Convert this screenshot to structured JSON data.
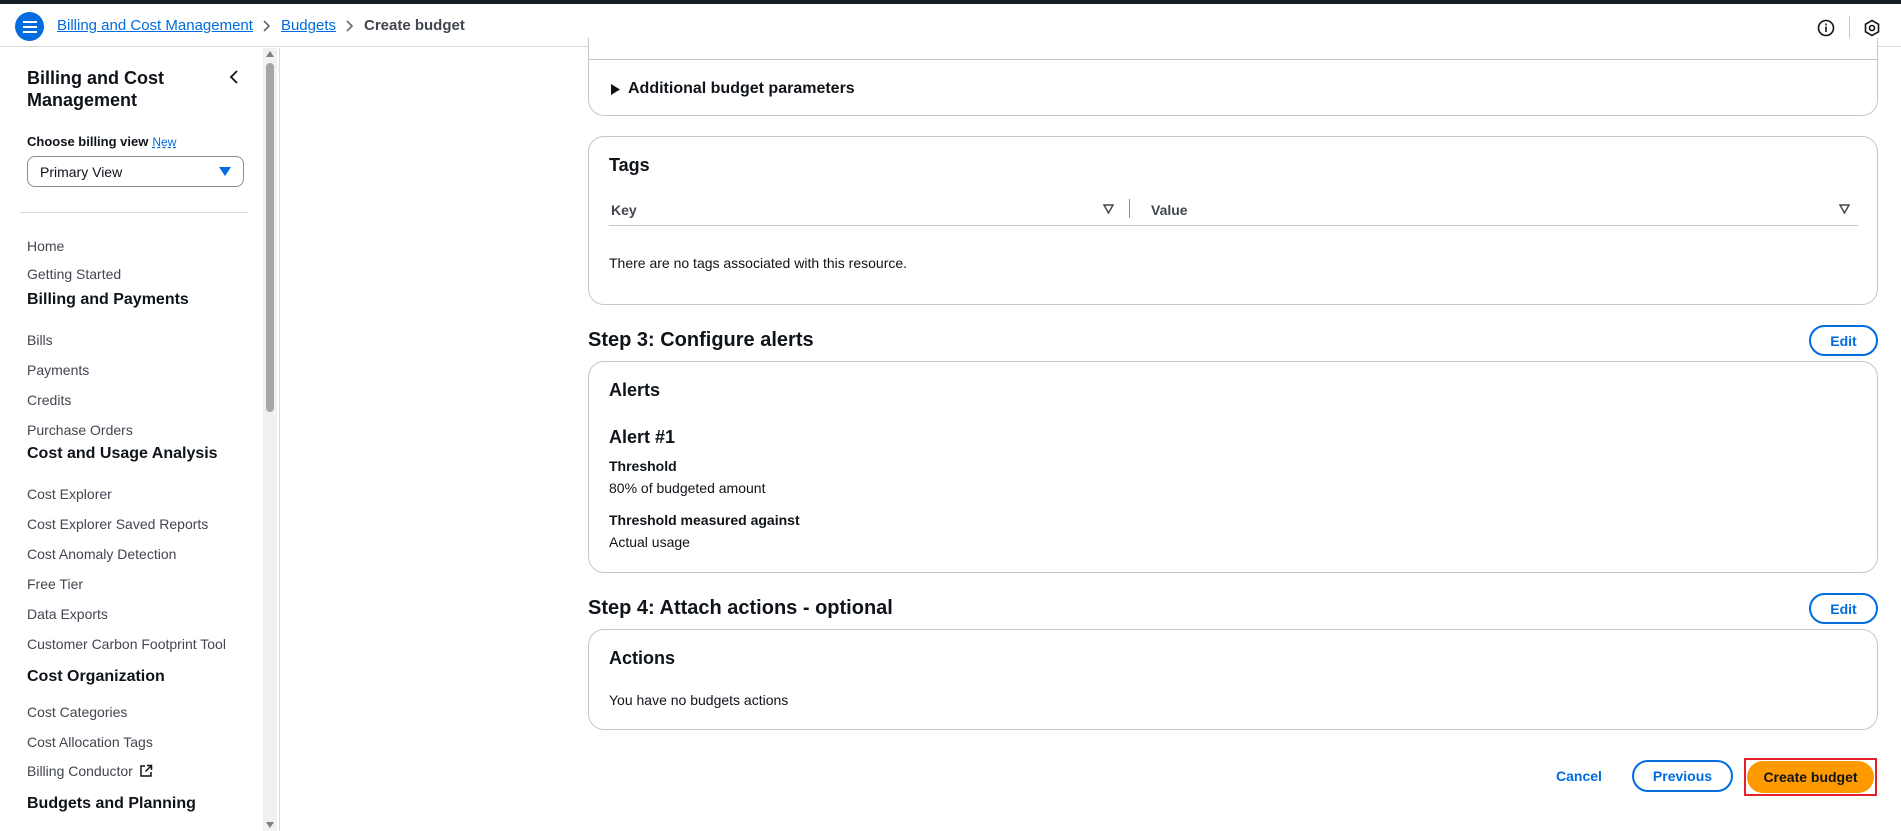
{
  "header": {
    "breadcrumbs": [
      "Billing and Cost Management",
      "Budgets",
      "Create budget"
    ]
  },
  "sidebar": {
    "title": "Billing and Cost Management",
    "choose_view_label": "Choose billing view",
    "new_badge": "New",
    "selected_view": "Primary View",
    "items": [
      {
        "type": "link",
        "label": "Home"
      },
      {
        "type": "link",
        "label": "Getting Started"
      },
      {
        "type": "heading",
        "label": "Billing and Payments"
      },
      {
        "type": "link",
        "label": "Bills"
      },
      {
        "type": "link",
        "label": "Payments"
      },
      {
        "type": "link",
        "label": "Credits"
      },
      {
        "type": "link",
        "label": "Purchase Orders"
      },
      {
        "type": "heading",
        "label": "Cost and Usage Analysis"
      },
      {
        "type": "link",
        "label": "Cost Explorer"
      },
      {
        "type": "link",
        "label": "Cost Explorer Saved Reports"
      },
      {
        "type": "link",
        "label": "Cost Anomaly Detection"
      },
      {
        "type": "link",
        "label": "Free Tier"
      },
      {
        "type": "link",
        "label": "Data Exports"
      },
      {
        "type": "link",
        "label": "Customer Carbon Footprint Tool"
      },
      {
        "type": "heading",
        "label": "Cost Organization"
      },
      {
        "type": "link",
        "label": "Cost Categories"
      },
      {
        "type": "link",
        "label": "Cost Allocation Tags"
      },
      {
        "type": "link",
        "label": "Billing Conductor",
        "external": true
      },
      {
        "type": "heading",
        "label": "Budgets and Planning"
      }
    ]
  },
  "main": {
    "additional_params_label": "Additional budget parameters",
    "tags": {
      "title": "Tags",
      "columns": [
        "Key",
        "Value"
      ],
      "empty_text": "There are no tags associated with this resource."
    },
    "step3": {
      "title": "Step 3: Configure alerts",
      "edit_label": "Edit",
      "card_title": "Alerts",
      "alert_title": "Alert #1",
      "threshold_label": "Threshold",
      "threshold_value": "80% of budgeted amount",
      "measured_label": "Threshold measured against",
      "measured_value": "Actual usage"
    },
    "step4": {
      "title": "Step 4: Attach actions - optional",
      "edit_label": "Edit",
      "card_title": "Actions",
      "empty_text": "You have no budgets actions"
    },
    "footer": {
      "cancel_label": "Cancel",
      "previous_label": "Previous",
      "create_label": "Create budget"
    }
  },
  "colors": {
    "accent": "#006ce0",
    "primary_button": "#ff9900",
    "highlight_border": "#e0202a"
  }
}
